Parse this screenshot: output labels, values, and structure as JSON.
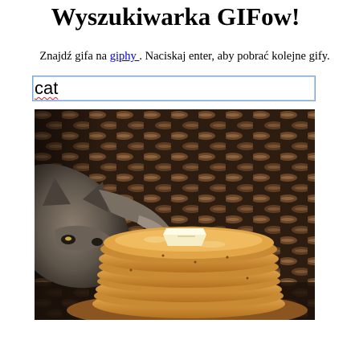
{
  "page": {
    "title": "Wyszukiwarka GIFow!",
    "description_before": "Znajdź gifa na ",
    "link_label": "giphy ",
    "description_after": ". Naciskaj enter, aby pobrać kolejne gify."
  },
  "search": {
    "value": "cat"
  },
  "gif": {
    "subject": "cat reaching for a stack of pancakes with butter",
    "colors": {
      "background": "#2a1a10",
      "pancake": "#d99a3a",
      "butter": "#f6eec6"
    }
  },
  "colors": {
    "link": "#0000ee",
    "input_border": "#7aa7d6"
  }
}
